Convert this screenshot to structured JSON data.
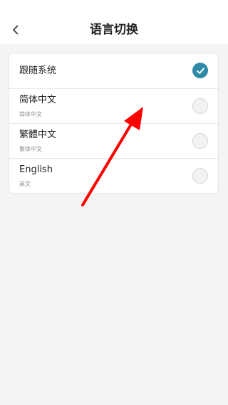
{
  "header": {
    "title": "语言切换"
  },
  "languages": [
    {
      "label": "跟随系统",
      "sublabel": "",
      "selected": true
    },
    {
      "label": "简体中文",
      "sublabel": "简体中文",
      "selected": false
    },
    {
      "label": "繁體中文",
      "sublabel": "繁体中文",
      "selected": false
    },
    {
      "label": "English",
      "sublabel": "英文",
      "selected": false
    }
  ],
  "colors": {
    "accent": "#2e8aa6",
    "annotation_arrow": "#ff0000"
  }
}
